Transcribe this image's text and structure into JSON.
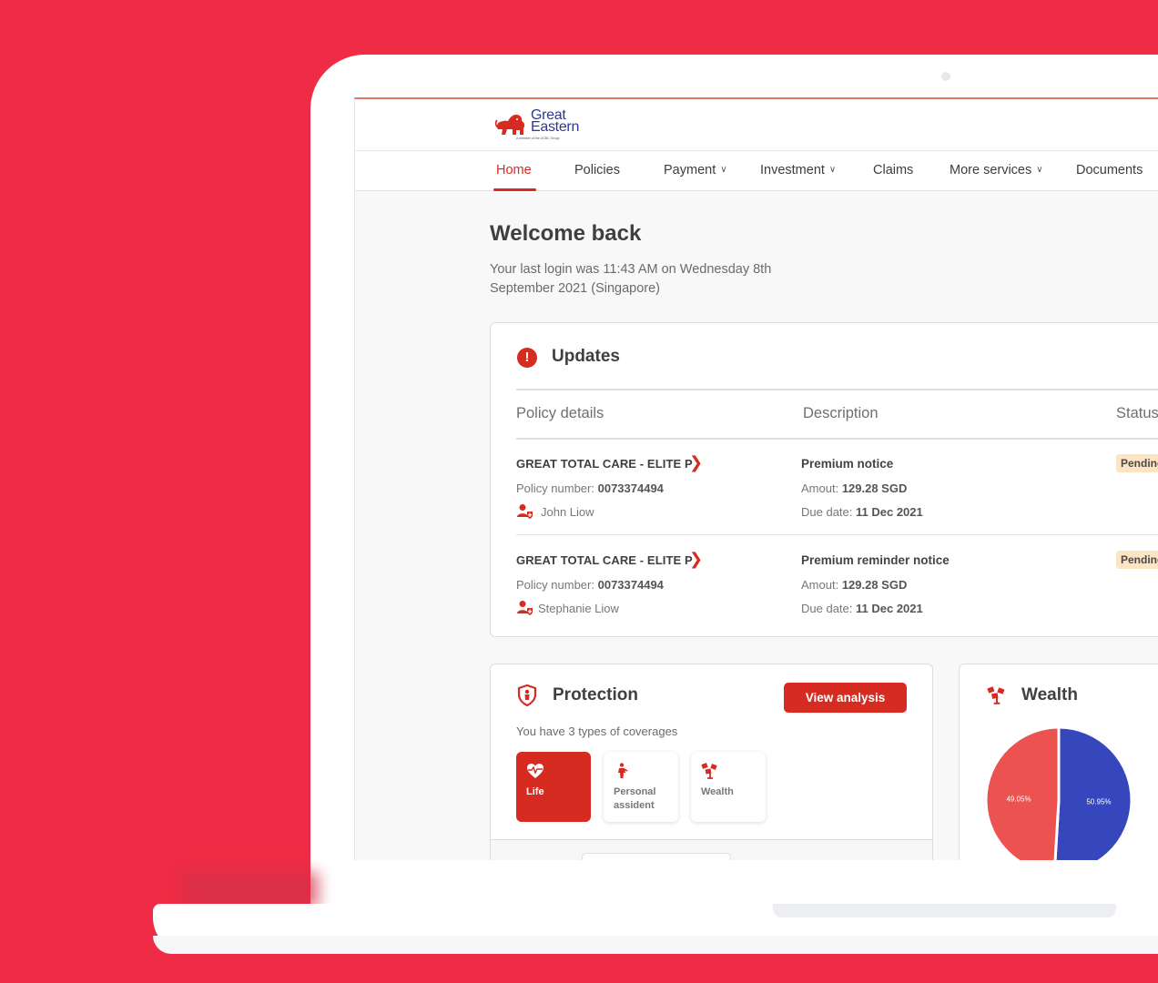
{
  "brand": {
    "name_line1": "Great",
    "name_line2": "Eastern",
    "tagline": "A member of the OCBC Group",
    "accent_color": "#d62b20",
    "logo_blue": "#2b3a8f"
  },
  "nav": {
    "items": [
      {
        "label": "Home",
        "active": true,
        "has_dropdown": false
      },
      {
        "label": "Policies",
        "active": false,
        "has_dropdown": false
      },
      {
        "label": "Payment",
        "active": false,
        "has_dropdown": true
      },
      {
        "label": "Investment",
        "active": false,
        "has_dropdown": true
      },
      {
        "label": "Claims",
        "active": false,
        "has_dropdown": false
      },
      {
        "label": "More services",
        "active": false,
        "has_dropdown": true
      },
      {
        "label": "Documents",
        "active": false,
        "has_dropdown": false
      }
    ]
  },
  "welcome": {
    "title": "Welcome back",
    "last_login": "Your last login was 11:43 AM on Wednesday 8th September 2021 (Singapore)"
  },
  "updates": {
    "title": "Updates",
    "columns": [
      "Policy details",
      "Description",
      "Status"
    ],
    "rows": [
      {
        "policy_name": "GREAT TOTAL CARE - ELITE P",
        "policy_number_label": "Policy number:",
        "policy_number": "0073374494",
        "insured": "John Liow",
        "description": "Premium notice",
        "amount_label": "Amout:",
        "amount": "129.28 SGD",
        "due_label": "Due date:",
        "due_date": "11 Dec 2021",
        "status": "Pending"
      },
      {
        "policy_name": "GREAT TOTAL CARE - ELITE P",
        "policy_number_label": "Policy number:",
        "policy_number": "0073374494",
        "insured": "Stephanie Liow",
        "description": "Premium reminder notice",
        "amount_label": "Amout:",
        "amount": "129.28 SGD",
        "due_label": "Due date:",
        "due_date": "11 Dec 2021",
        "status": "Pending"
      }
    ]
  },
  "protection": {
    "title": "Protection",
    "button": "View analysis",
    "subtitle": "You have 3 types of coverages",
    "coverages": [
      {
        "label": "Life",
        "icon": "heart-pulse-icon",
        "active": true
      },
      {
        "label": "Personal assident",
        "icon": "person-icon",
        "active": false
      },
      {
        "label": "Wealth",
        "icon": "money-tree-icon",
        "active": false
      }
    ]
  },
  "wealth": {
    "title": "Wealth"
  },
  "chart_data": {
    "type": "pie",
    "title": "Wealth",
    "slices": [
      {
        "label": "50.95%",
        "value": 50.95,
        "color": "#3646bd"
      },
      {
        "label": "49.05%",
        "value": 49.05,
        "color": "#ec5250"
      }
    ]
  }
}
